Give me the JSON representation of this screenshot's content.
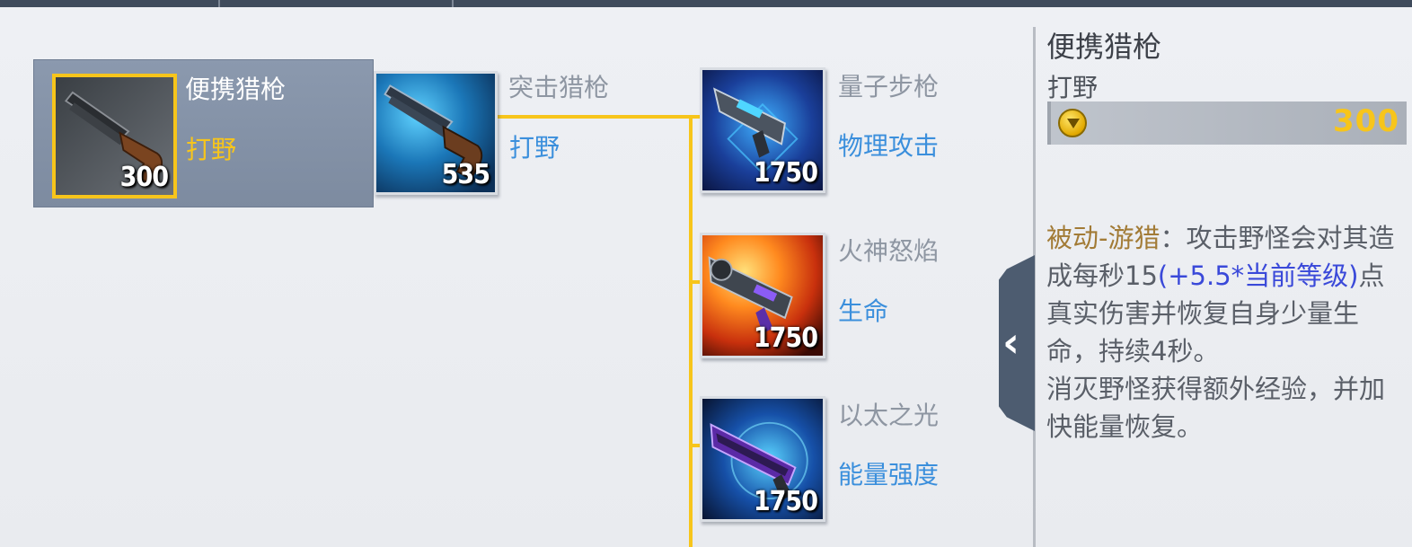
{
  "colors": {
    "accent_line": "#f7c51b",
    "category_blue": "#3b8fdc",
    "formula_blue": "#3a49d9",
    "passive_label": "#a27b36"
  },
  "tree": {
    "root": {
      "name": "便携猎枪",
      "category": "打野",
      "cost": "300",
      "icon": "shotgun-icon"
    },
    "tier2": {
      "name": "突击猎枪",
      "category": "打野",
      "cost": "535",
      "icon": "assault-shotgun-icon"
    },
    "tier3": [
      {
        "name": "量子步枪",
        "category": "物理攻击",
        "cost": "1750",
        "icon": "quantum-rifle-icon"
      },
      {
        "name": "火神怒焰",
        "category": "生命",
        "cost": "1750",
        "icon": "vulcan-fury-icon"
      },
      {
        "name": "以太之光",
        "category": "能量强度",
        "cost": "1750",
        "icon": "ether-light-icon"
      }
    ]
  },
  "detail": {
    "title": "便携猎枪",
    "category": "打野",
    "cost": "300",
    "passive_label": "被动-游猎",
    "colon": "：",
    "text_before": "攻击野怪会对其造成每秒15",
    "formula": "(+5.5*当前等级)",
    "text_after": "点真实伤害并恢复自身少量生命，持续4秒。",
    "text_line2": "消灭野怪获得额外经验，并加快能量恢复。"
  },
  "collapse_glyph": "‹"
}
